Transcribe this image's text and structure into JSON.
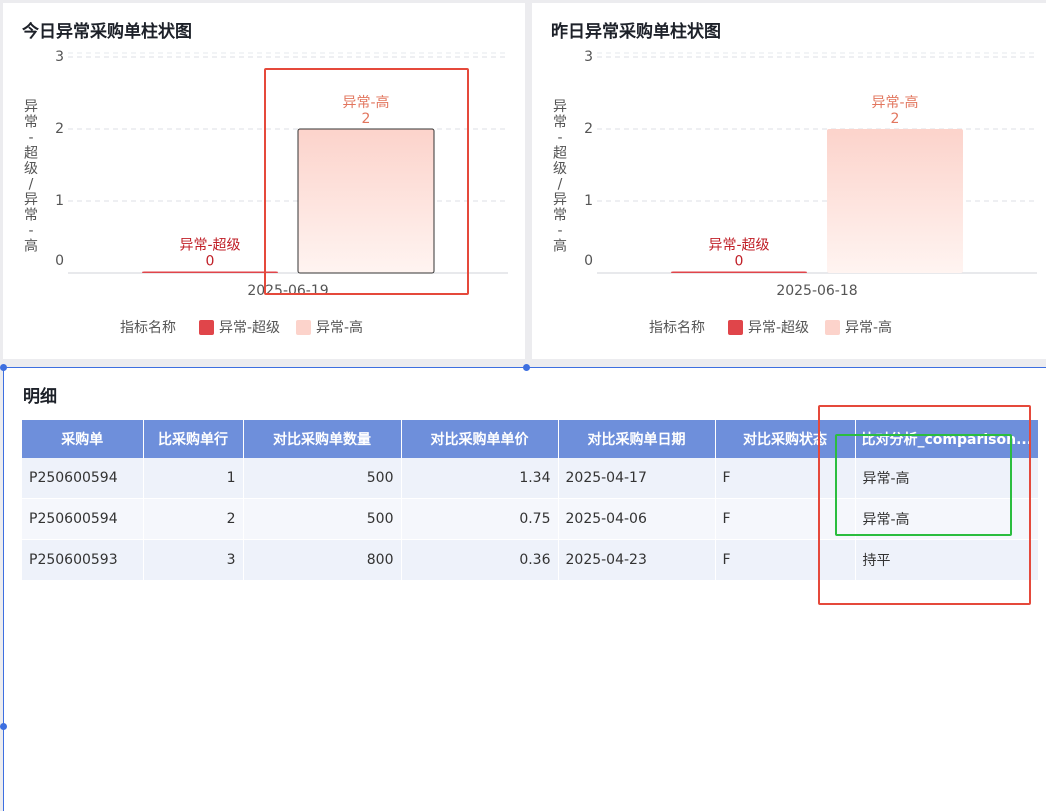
{
  "panels": {
    "today": {
      "title": "今日异常采购单柱状图"
    },
    "yesterday": {
      "title": "昨日异常采购单柱状图"
    },
    "detail": {
      "title": "明细"
    }
  },
  "chart_data": [
    {
      "type": "bar",
      "title": "今日异常采购单柱状图",
      "ylabel": "异常-超级/异常-高",
      "ylim": [
        0,
        3
      ],
      "yticks": [
        "0",
        "1",
        "2",
        "3"
      ],
      "grid": true,
      "categories": [
        "2025-06-19"
      ],
      "legend_title": "指标名称",
      "legend_position": "bottom",
      "series": [
        {
          "name": "异常-超级",
          "values": [
            0
          ],
          "color": "#e0454a"
        },
        {
          "name": "异常-高",
          "values": [
            2
          ],
          "color": "#fcd3cb"
        }
      ]
    },
    {
      "type": "bar",
      "title": "昨日异常采购单柱状图",
      "ylabel": "异常-超级/异常-高",
      "ylim": [
        0,
        3
      ],
      "yticks": [
        "0",
        "1",
        "2",
        "3"
      ],
      "grid": true,
      "categories": [
        "2025-06-18"
      ],
      "legend_title": "指标名称",
      "legend_position": "bottom",
      "series": [
        {
          "name": "异常-超级",
          "values": [
            0
          ],
          "color": "#e0454a"
        },
        {
          "name": "异常-高",
          "values": [
            2
          ],
          "color": "#fcd3cb"
        }
      ]
    }
  ],
  "table": {
    "headers": [
      "采购单",
      "比采购单行",
      "对比采购单数量",
      "对比采购单单价",
      "对比采购单日期",
      "对比采购状态",
      "比对分析_comparison..."
    ],
    "rows": [
      [
        "P250600594",
        "1",
        "500",
        "1.34",
        "2025-04-17",
        "F",
        "异常-高"
      ],
      [
        "P250600594",
        "2",
        "500",
        "0.75",
        "2025-04-06",
        "F",
        "异常-高"
      ],
      [
        "P250600593",
        "3",
        "800",
        "0.36",
        "2025-04-23",
        "F",
        "持平"
      ]
    ]
  },
  "colors": {
    "header_bg": "#6e8fdb",
    "highlight_red": "#e5493b",
    "highlight_green": "#2bbd3f",
    "selection": "#3d6fe0"
  }
}
